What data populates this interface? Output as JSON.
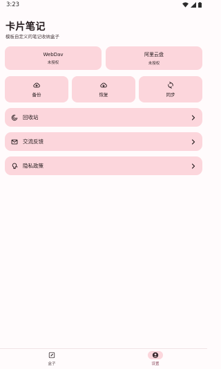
{
  "status_bar": {
    "time": "3:23"
  },
  "header": {
    "title": "卡片笔记",
    "subtitle": "模板自定义的笔记收纳盒子"
  },
  "cloud_cards": [
    {
      "name": "WebDav",
      "status": "未授权"
    },
    {
      "name": "阿里云盘",
      "status": "未授权"
    }
  ],
  "actions": [
    {
      "label": "备份",
      "icon": "cloud-upload-icon"
    },
    {
      "label": "恢复",
      "icon": "cloud-download-icon"
    },
    {
      "label": "同步",
      "icon": "sync-icon"
    }
  ],
  "menu": [
    {
      "label": "回收站",
      "icon": "recycle-icon"
    },
    {
      "label": "交流反馈",
      "icon": "mail-icon"
    },
    {
      "label": "隐私政策",
      "icon": "lightbulb-icon"
    }
  ],
  "bottom_nav": [
    {
      "label": "盒子",
      "icon": "box-edit-icon",
      "active": false
    },
    {
      "label": "设置",
      "icon": "account-icon",
      "active": true
    }
  ],
  "colors": {
    "background": "#fffbfc",
    "card": "#fcd6dc",
    "text": "#231a1c",
    "accent": "#8c4a5e"
  }
}
